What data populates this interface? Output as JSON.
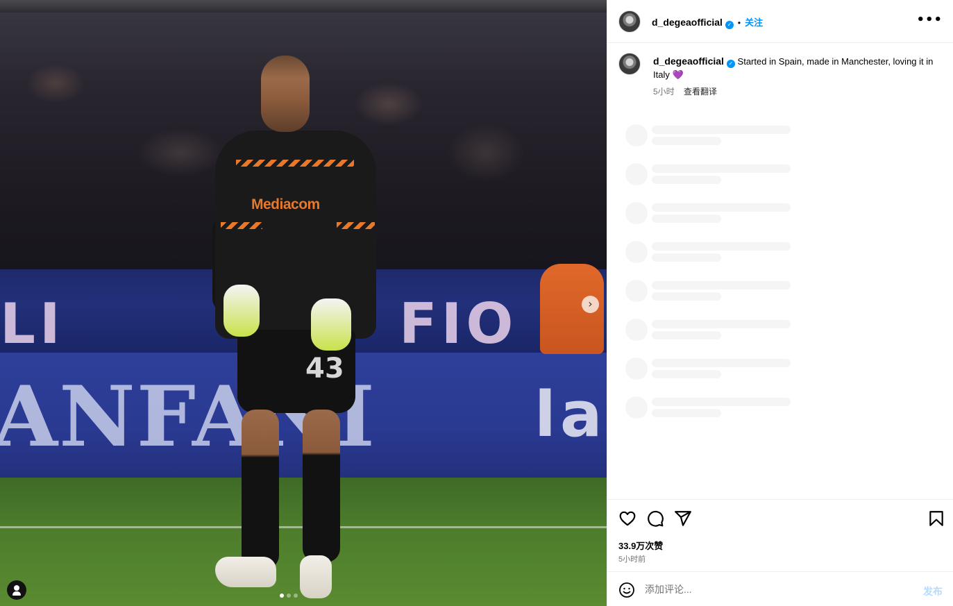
{
  "media": {
    "board_text_1": "LI",
    "board_text_2": "FIO",
    "board_text_3": "ANFANI",
    "board_text_4": "la",
    "jersey_sponsor": "Mediacom",
    "jersey_number": "43",
    "next_icon": "chevron-right-icon",
    "slide_count": 3,
    "active_slide": 1
  },
  "header": {
    "username": "d_degeaofficial",
    "separator": "•",
    "follow_label": "关注",
    "more_label": "•••"
  },
  "caption": {
    "username": "d_degeaofficial",
    "text": "Started in Spain, made in Manchester, loving it in Italy",
    "emoji": "💜",
    "time": "5小时",
    "translate_label": "查看翻译"
  },
  "actions": {
    "likes": "33.9万次赞",
    "time": "5小时前",
    "icons": [
      "heart-icon",
      "comment-icon",
      "share-icon",
      "bookmark-icon"
    ]
  },
  "comment": {
    "placeholder": "添加评论...",
    "post_label": "发布"
  },
  "colors": {
    "accent": "#0095f6",
    "post_disabled": "#b3dbff",
    "muted": "#737373"
  }
}
